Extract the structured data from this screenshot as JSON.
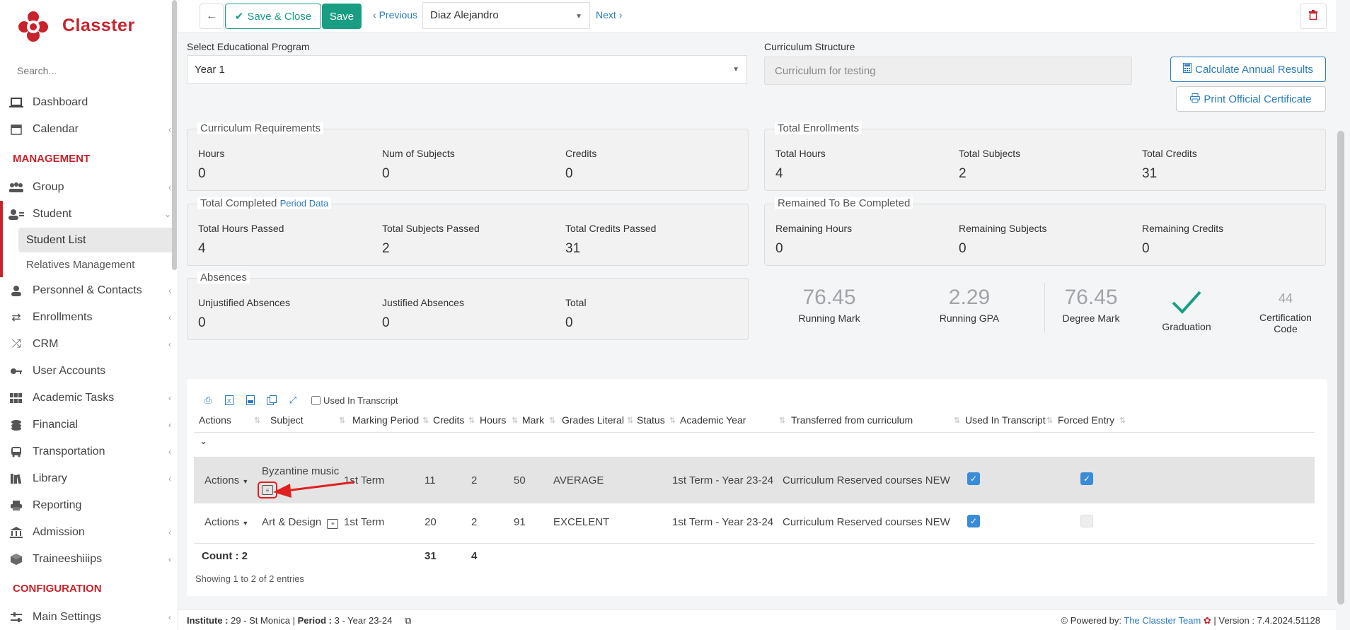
{
  "brand": {
    "name": "Classter",
    "color": "#c8232c"
  },
  "sidebar": {
    "search_placeholder": "Search...",
    "items": [
      {
        "label": "Dashboard",
        "icon": "laptop-icon"
      },
      {
        "label": "Calendar",
        "icon": "calendar-icon"
      }
    ],
    "section_management": "MANAGEMENT",
    "mgmt_items": [
      {
        "label": "Group",
        "icon": "group-icon"
      },
      {
        "label": "Student",
        "icon": "student-icon"
      }
    ],
    "student_sub": [
      "Student List",
      "Relatives Management"
    ],
    "more_items": [
      {
        "label": "Personnel & Contacts",
        "icon": "person-icon"
      },
      {
        "label": "Enrollments",
        "icon": "exchange-icon"
      },
      {
        "label": "CRM",
        "icon": "shuffle-icon"
      },
      {
        "label": "User Accounts",
        "icon": "key-icon"
      },
      {
        "label": "Academic Tasks",
        "icon": "grid-icon"
      },
      {
        "label": "Financial",
        "icon": "coins-icon"
      },
      {
        "label": "Transportation",
        "icon": "bus-icon"
      },
      {
        "label": "Library",
        "icon": "books-icon"
      },
      {
        "label": "Reporting",
        "icon": "printer-icon"
      },
      {
        "label": "Admission",
        "icon": "bank-icon"
      },
      {
        "label": "Traineeshiiips",
        "icon": "cube-icon"
      }
    ],
    "section_config": "CONFIGURATION",
    "config_items": [
      {
        "label": "Main Settings",
        "icon": "sliders-icon"
      }
    ]
  },
  "toolbar": {
    "save_close": "Save & Close",
    "save": "Save",
    "previous": "Previous",
    "next": "Next",
    "student": "Diaz Alejandro"
  },
  "program": {
    "label": "Select Educational Program",
    "value": "Year 1",
    "curriculum_label": "Curriculum Structure",
    "curriculum_placeholder": "Curriculum for testing",
    "calc_button": "Calculate Annual Results",
    "print_button": "Print Official Certificate"
  },
  "panels": {
    "req": {
      "title": "Curriculum Requirements",
      "stats": [
        {
          "label": "Hours",
          "value": "0"
        },
        {
          "label": "Num of Subjects",
          "value": "0"
        },
        {
          "label": "Credits",
          "value": "0"
        }
      ]
    },
    "enr": {
      "title": "Total Enrollments",
      "stats": [
        {
          "label": "Total Hours",
          "value": "4"
        },
        {
          "label": "Total Subjects",
          "value": "2"
        },
        {
          "label": "Total Credits",
          "value": "31"
        }
      ]
    },
    "comp": {
      "title": "Total Completed",
      "link": "Period Data",
      "stats": [
        {
          "label": "Total Hours Passed",
          "value": "4"
        },
        {
          "label": "Total Subjects Passed",
          "value": "2"
        },
        {
          "label": "Total Credits Passed",
          "value": "31"
        }
      ]
    },
    "rem": {
      "title": "Remained To Be Completed",
      "stats": [
        {
          "label": "Remaining Hours",
          "value": "0"
        },
        {
          "label": "Remaining Subjects",
          "value": "0"
        },
        {
          "label": "Remaining Credits",
          "value": "0"
        }
      ]
    },
    "abs": {
      "title": "Absences",
      "stats": [
        {
          "label": "Unjustified Absences",
          "value": "0"
        },
        {
          "label": "Justified Absences",
          "value": "0"
        },
        {
          "label": "Total",
          "value": "0"
        }
      ]
    }
  },
  "metrics": {
    "running_mark": {
      "value": "76.45",
      "label": "Running Mark"
    },
    "running_gpa": {
      "value": "2.29",
      "label": "Running GPA"
    },
    "degree_mark": {
      "value": "76.45",
      "label": "Degree Mark"
    },
    "graduation": {
      "label": "Graduation"
    },
    "cert": {
      "value": "44",
      "label1": "Certification",
      "label2": "Code"
    }
  },
  "table": {
    "used_in_transcript_filter": "Used In Transcript",
    "columns": [
      "Actions",
      "Subject",
      "Marking Period",
      "Credits",
      "Hours",
      "Mark",
      "Grades Literal",
      "Status",
      "Academic Year",
      "Transferred from curriculum",
      "Used In Transcript",
      "Forced Entry"
    ],
    "rows": [
      {
        "actions": "Actions",
        "subject": "Byzantine music",
        "period": "1st Term",
        "credits": "11",
        "hours": "2",
        "mark": "50",
        "literal": "AVERAGE",
        "status": "",
        "year": "1st Term - Year 23-24",
        "transferred": "Curriculum Reserved courses NEW",
        "used": true,
        "forced": true
      },
      {
        "actions": "Actions",
        "subject": "Art & Design",
        "period": "1st Term",
        "credits": "20",
        "hours": "2",
        "mark": "91",
        "literal": "EXCELENT",
        "status": "",
        "year": "1st Term - Year 23-24",
        "transferred": "Curriculum Reserved courses NEW",
        "used": true,
        "forced": false
      }
    ],
    "count_label": "Count : 2",
    "count_credits": "31",
    "count_hours": "4",
    "showing": "Showing 1 to 2 of 2 entries"
  },
  "footer": {
    "institute_label": "Institute :",
    "institute_value": "29 - St Monica",
    "period_label": "Period :",
    "period_value": "3 - Year 23-24",
    "powered": "Powered by:",
    "team": "The Classter Team",
    "version": "| Version : 7.4.2024.51128"
  },
  "colors": {
    "accent": "#1a9e83",
    "link": "#2a7bc0",
    "danger": "#c8232c",
    "check": "#1a9e83"
  }
}
